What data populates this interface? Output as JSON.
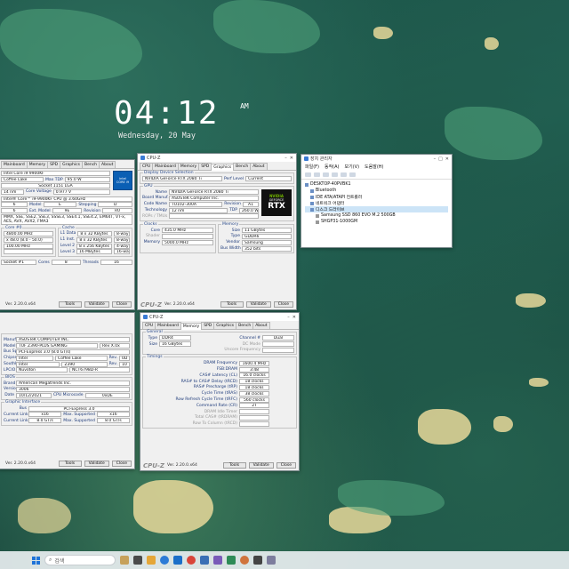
{
  "lockscreen": {
    "time": "04:12",
    "ampm": "AM",
    "date": "Wednesday, 20 May"
  },
  "cpu_window": {
    "tabs": [
      "Mainboard",
      "Memory",
      "SPD",
      "Graphics",
      "Bench",
      "About"
    ],
    "name": "Intel Core i9 9900KF",
    "codename": "Coffee Lake",
    "max_tdp_label": "Max TDP",
    "max_tdp": "95.0 W",
    "package": "Socket 1151 LGA",
    "technology": "14 nm",
    "core_voltage_label": "Core Voltage",
    "core_voltage": "0.977 V",
    "spec": "Intel® Core™ i9-9900KF CPU @ 3.60GHz",
    "family": "6",
    "model_label": "Model",
    "model": "E",
    "stepping_label": "Stepping",
    "stepping": "D",
    "ext_family": "6",
    "ext_model_label": "Ext. Model",
    "ext_model": "9E",
    "revision_label": "Revision",
    "revision": "R0",
    "instructions": "MMX, SSE, SSE2, SSE3, SSSE3, SSE4.1, SSE4.2, EM64T, VT-x, AES, AVX, AVX2, FMA3",
    "clocks_title": "Core #0",
    "cache_title": "Cache",
    "core_speed": "4800.00 MHz",
    "multiplier": "x 48.0 (8.0 - 50.0)",
    "bus_speed": "100.00 MHz",
    "l1d_label": "L1 Data",
    "l1d": "8 x 32 KBytes",
    "l1d_way": "8-way",
    "l1i_label": "L1 Inst.",
    "l1i": "8 x 32 KBytes",
    "l1i_way": "8-way",
    "l2_label": "Level 2",
    "l2": "8 x 256 KBytes",
    "l2_way": "4-way",
    "l3_label": "Level 3",
    "l3": "16 MBytes",
    "l3_way": "16-way",
    "selection": "Socket #1",
    "cores_label": "Cores",
    "cores": "8",
    "threads_label": "Threads",
    "threads": "16",
    "chip_line1": "intel",
    "chip_line2": "CORE i9",
    "version": "Ver. 2.20.0.x64",
    "tools_label": "Tools",
    "validate_label": "Validate",
    "close_label": "Close"
  },
  "gpu_window": {
    "title": "CPU-Z",
    "tabs": [
      "CPU",
      "Mainboard",
      "Memory",
      "SPD",
      "Graphics",
      "Bench",
      "About"
    ],
    "group_selection": "Display Device Selection",
    "device": "NVIDIA GeForce RTX 2080 Ti",
    "perf_level_label": "Perf Level",
    "perf_level": "Current",
    "group_gpu": "GPU",
    "name_label": "Name",
    "name": "NVIDIA GeForce RTX 2080 Ti",
    "board_label": "Board Manuf.",
    "board": "ASUSTeK Computer Inc.",
    "code_label": "Code Name",
    "code": "TU102-300A",
    "revision_label": "Revision",
    "revision": "A1",
    "tech_label": "Technology",
    "tech": "12 nm",
    "tdp_label": "TDP",
    "tdp": "260.0 W",
    "rops_label": "ROPs / TMUs",
    "group_clocks": "Clocks",
    "core_label": "Core",
    "core": "435.0 MHz",
    "shader_label": "Shader",
    "memclk_label": "Memory",
    "memclk": "5000.0 MHz",
    "group_memory": "Memory",
    "size_label": "Size",
    "size": "11 GBytes",
    "type_label": "Type",
    "type": "GDDR6",
    "vendor_label": "Vendor",
    "vendor": "Samsung",
    "buswidth_label": "Bus Width",
    "buswidth": "352 bits",
    "logo_vendor": "NVIDIA",
    "logo_brand": "GEFORCE",
    "logo_model": "RTX",
    "version": "Ver. 2.20.0.x64",
    "tools_label": "Tools",
    "validate_label": "Validate",
    "close_label": "Close"
  },
  "mb_window": {
    "manufacturer_label": "Manufacturer",
    "manufacturer": "ASUSTeK COMPUTER INC.",
    "model_label": "Model",
    "model": "TUF Z390-PLUS GAMING",
    "model_rev": "Rev X.0x",
    "bus_specs_label": "Bus Specs.",
    "bus_specs": "PCI-Express 3.0 (8.0 GT/s)",
    "chipset_label": "Chipset",
    "chipset_a": "Intel",
    "chipset_b": "Coffee Lake",
    "chipset_rev_label": "Rev.",
    "chipset_rev": "0D",
    "southbridge_label": "Southbridge",
    "south_a": "Intel",
    "south_b": "Z390",
    "south_rev_label": "Rev.",
    "south_rev": "10",
    "lpcio_label": "LPCIO",
    "lpcio_a": "Nuvoton",
    "lpcio_b": "NCT6798D-R",
    "bios_title": "BIOS",
    "brand_label": "Brand",
    "brand": "American Megatrends Inc.",
    "version_label": "Version",
    "bios_version": "3006",
    "date_label": "Date",
    "date": "10/12/2021",
    "microcode_label": "CPU Microcode",
    "microcode": "0xDE",
    "gi_title": "Graphic Interface",
    "gi_bus_label": "Bus",
    "gi_bus": "PCI-Express 3.0",
    "gi_width_label": "Current Link Width",
    "gi_width": "x16",
    "gi_maxw_label": "Max. Supported",
    "gi_maxw": "x16",
    "gi_speed_label": "Current Link Speed",
    "gi_speed": "8.0 GT/s",
    "gi_maxs_label": "Max. Supported",
    "gi_maxs": "8.0 GT/s",
    "version": "Ver. 2.20.0.x64",
    "tools_label": "Tools",
    "validate_label": "Validate",
    "close_label": "Close"
  },
  "mem_window": {
    "title": "CPU-Z",
    "tabs": [
      "CPU",
      "Mainboard",
      "Memory",
      "SPD",
      "Graphics",
      "Bench",
      "About"
    ],
    "general_title": "General",
    "type_label": "Type",
    "type": "DDR4",
    "channel_label": "Channel #",
    "channel": "Dual",
    "size_label": "Size",
    "size": "16 GBytes",
    "dc_mode_label": "DC Mode",
    "uncore_label": "Uncore Frequency",
    "timings_title": "Timings",
    "timings": [
      {
        "label": "DRAM Frequency",
        "value": "1600.4 MHz"
      },
      {
        "label": "FSB:DRAM",
        "value": "3:48"
      },
      {
        "label": "CAS# Latency (CL)",
        "value": "16.0 clocks"
      },
      {
        "label": "RAS# to CAS# Delay (tRCD)",
        "value": "18 clocks"
      },
      {
        "label": "RAS# Precharge (tRP)",
        "value": "18 clocks"
      },
      {
        "label": "Cycle Time (tRAS)",
        "value": "38 clocks"
      },
      {
        "label": "Row Refresh Cycle Time (tRFC)",
        "value": "560 clocks"
      },
      {
        "label": "Command Rate (CR)",
        "value": "2T"
      },
      {
        "label": "DRAM Idle Timer",
        "value": ""
      },
      {
        "label": "Total CAS# (tRDRAM)",
        "value": ""
      },
      {
        "label": "Row To Column (tRCD)",
        "value": ""
      }
    ],
    "version": "Ver. 2.20.0.x64",
    "tools_label": "Tools",
    "validate_label": "Validate",
    "close_label": "Close"
  },
  "devmgr": {
    "title": "장치 관리자",
    "menu": [
      "파일(F)",
      "동작(A)",
      "보기(V)",
      "도움말(H)"
    ],
    "nodes": [
      {
        "label": "DESKTOP-40PVBK1",
        "indent": 0
      },
      {
        "label": "Bluetooth",
        "indent": 1
      },
      {
        "label": "IDE ATA/ATAPI 컨트롤러",
        "indent": 1
      },
      {
        "label": "네트워크 어댑터",
        "indent": 1
      },
      {
        "label": "디스크 드라이브",
        "indent": 1,
        "selected": true
      },
      {
        "label": "Samsung SSD 860 EVO M.2 500GB",
        "indent": 2
      },
      {
        "label": "SHGP31-1000GM",
        "indent": 2
      }
    ]
  },
  "taskbar": {
    "search_placeholder": "검색"
  },
  "colors": {
    "accent": "#1e73d8",
    "cpuz_label": "#1d3a7a",
    "nvidia_green": "#76b900"
  }
}
